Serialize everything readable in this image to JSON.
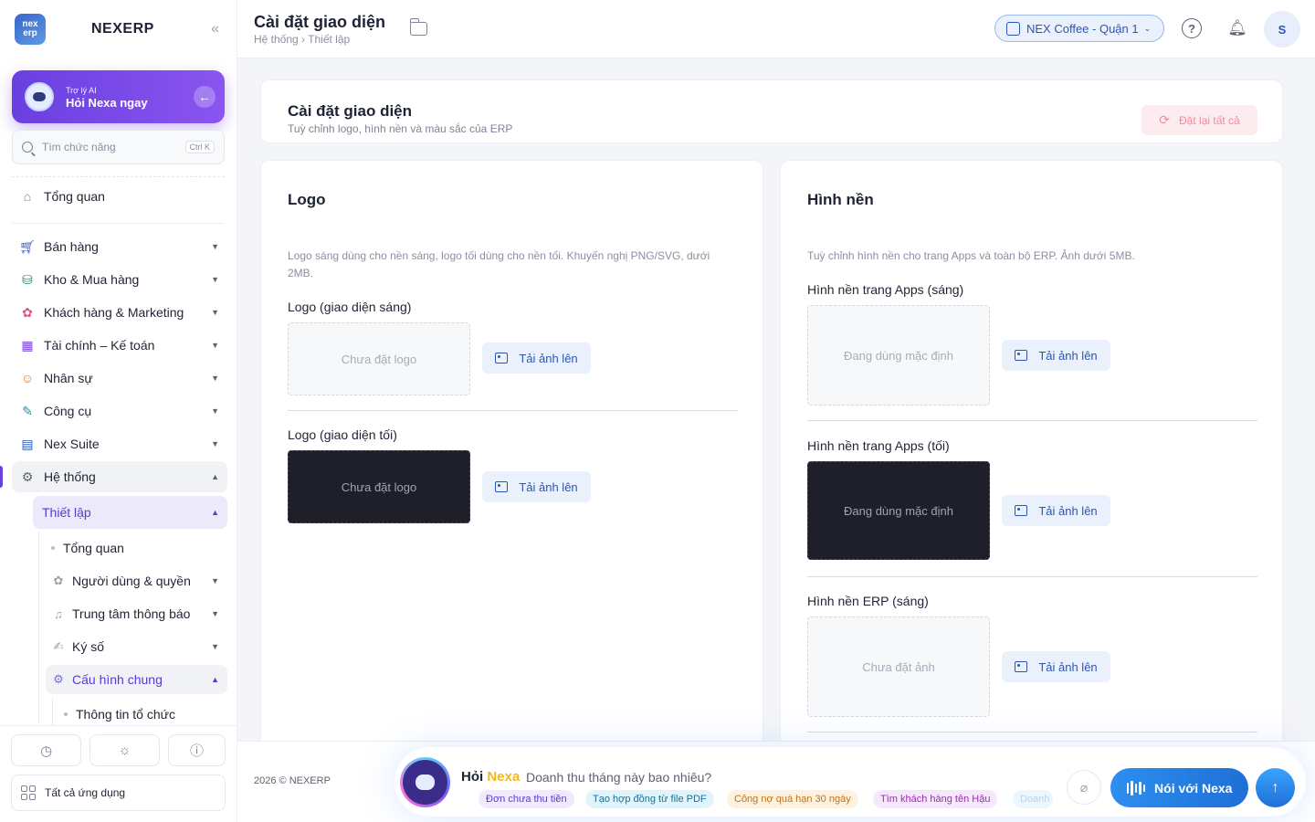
{
  "sidebar": {
    "brand": {
      "logo_top": "nex",
      "logo_bottom": "erp",
      "name": "NEXERP",
      "collapse_icon": "«"
    },
    "ai_card": {
      "subtitle": "Trợ lý AI",
      "title": "Hỏi Nexa ngay"
    },
    "search": {
      "placeholder": "Tìm chức năng",
      "shortcut": "Ctrl K"
    },
    "overview": "Tổng quan",
    "nav": [
      {
        "label": "Bán hàng",
        "icon": "cart-icon"
      },
      {
        "label": "Kho & Mua hàng",
        "icon": "bag-icon"
      },
      {
        "label": "Khách hàng & Marketing",
        "icon": "users-icon"
      },
      {
        "label": "Tài chính – Kế toán",
        "icon": "calculator-icon"
      },
      {
        "label": "Nhân sự",
        "icon": "person-icon"
      },
      {
        "label": "Công cụ",
        "icon": "wrench-icon"
      },
      {
        "label": "Nex Suite",
        "icon": "document-icon"
      },
      {
        "label": "Hệ thống",
        "icon": "gear-icon"
      }
    ],
    "setup": "Thiết lập",
    "sub_items": [
      {
        "label": "Tổng quan"
      },
      {
        "label": "Người dùng & quyền"
      },
      {
        "label": "Trung tâm thông báo"
      },
      {
        "label": "Ký số"
      },
      {
        "label": "Cấu hình chung"
      },
      {
        "label": "Thông tin tổ chức"
      }
    ],
    "all_apps": "Tất cả ứng dụng"
  },
  "topbar": {
    "title": "Cài đặt giao diện",
    "breadcrumb": "Hệ thống › Thiết lập",
    "store": "NEX Coffee - Quận 1",
    "avatar_initial": "S"
  },
  "header_card": {
    "title": "Cài đặt giao diện",
    "subtitle": "Tuỳ chỉnh logo, hình nền và màu sắc của ERP",
    "reset_label": "Đặt lại tất cả"
  },
  "logo_panel": {
    "title": "Logo",
    "description": "Logo sáng dùng cho nền sáng, logo tối dùng cho nền tối. Khuyến nghị PNG/SVG, dưới 2MB.",
    "items": [
      {
        "label": "Logo (giao diện sáng)",
        "placeholder": "Chưa đặt logo",
        "button": "Tải ảnh lên"
      },
      {
        "label": "Logo (giao diện tối)",
        "placeholder": "Chưa đặt logo",
        "button": "Tải ảnh lên"
      }
    ]
  },
  "background_panel": {
    "title": "Hình nền",
    "description": "Tuỳ chỉnh hình nền cho trang Apps và toàn bộ ERP. Ảnh dưới 5MB.",
    "items": [
      {
        "label": "Hình nền trang Apps (sáng)",
        "placeholder": "Đang dùng mặc định",
        "button": "Tải ảnh lên"
      },
      {
        "label": "Hình nền trang Apps (tối)",
        "placeholder": "Đang dùng mặc định",
        "button": "Tải ảnh lên"
      },
      {
        "label": "Hình nền ERP (sáng)",
        "placeholder": "Chưa đặt ảnh",
        "button": "Tải ảnh lên"
      }
    ]
  },
  "footer": {
    "copyright": "2026 © NEXERP",
    "ask_prefix": "Hỏi",
    "ask_brand": "Nexa",
    "ask_placeholder": "Doanh thu tháng này bao nhiêu?",
    "chips": [
      "Đơn chưa thu tiền",
      "Tạo hợp đồng từ file PDF",
      "Công nợ quá hạn 30 ngày",
      "Tìm khách hàng tên Hậu",
      "Doanh"
    ],
    "voice_label": "Nói với Nexa"
  },
  "colors": {
    "accent_purple": "#6a3fe0",
    "accent_blue": "#2c56b4",
    "danger_soft": "#fdecef"
  }
}
